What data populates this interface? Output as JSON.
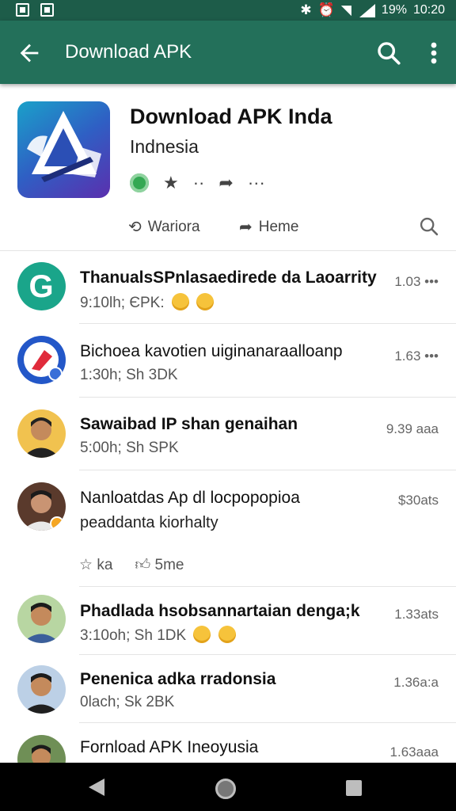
{
  "status_bar": {
    "battery": "19%",
    "time": "10:20"
  },
  "toolbar": {
    "title": "Download APK"
  },
  "header": {
    "title": "Download APK Inda",
    "subtitle": "Indnesia",
    "actions": [
      {
        "label": "Wariora"
      },
      {
        "label": "Heme"
      }
    ]
  },
  "list": [
    {
      "title": "ThanualsSPnlasaedirede da Laoarrity",
      "meta": "9:10lh; ЄPK:",
      "time": "1.03"
    },
    {
      "title": "Bichoea kavotien uiginanaraalloanp",
      "meta": "1:30h; Sh 3DK",
      "time": "1.63"
    },
    {
      "title": "Sawaibad IP shan genaihan",
      "meta": "5:00h; Sh SPK",
      "time": "9.39"
    },
    {
      "title": "Nanloatdas Ap dl locpopopioa",
      "meta": "peaddanta kiorhalty",
      "time": "$30ats",
      "actions": [
        "ka",
        "5me"
      ]
    },
    {
      "title": "Phadlada hsobsannartaian denga;k",
      "meta": "3:10oh; Sh 1DK",
      "time": "1.33ats"
    },
    {
      "title": "Penenica adka rradonsia",
      "meta": "0lach; Sk 2BK",
      "time": "1.36"
    },
    {
      "title": "Fornload APK Ineoyusia",
      "meta": "",
      "time": "1.63"
    }
  ],
  "colors": {
    "status_bar": "#1d5c49",
    "toolbar": "#23705a",
    "accent_green": "#34a853"
  }
}
